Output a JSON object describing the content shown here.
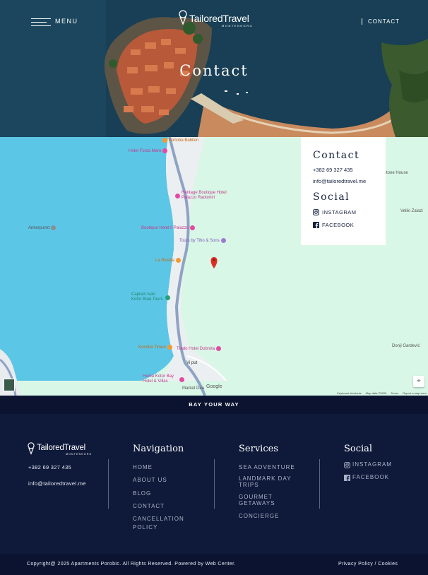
{
  "header": {
    "menu_label": "MENU",
    "logo_main": "TailoredTravel",
    "logo_sub": "MONTENEGRO",
    "contact_link": "CONTACT",
    "hero_title": "Contact"
  },
  "map": {
    "pois": [
      {
        "label": "Konoba Babilon",
        "color": "orange"
      },
      {
        "label": "Hotel Forza Mare",
        "color": "pink"
      },
      {
        "label": "Heritage Boutique Hotel Palazzo Radomiri",
        "color": "pink"
      },
      {
        "label": "Ankerpunkt",
        "color": "gray"
      },
      {
        "label": "Boutique Hotel Il Palazzo",
        "color": "pink"
      },
      {
        "label": "Tours by Tiho & Sons",
        "color": "purple"
      },
      {
        "label": "La Ricetta",
        "color": "orange"
      },
      {
        "label": "Captain Ivan Kotor Boat Tours",
        "color": "teal"
      },
      {
        "label": "Konoba Timun",
        "color": "orange"
      },
      {
        "label": "Tredo Hotel Dobrota",
        "color": "pink"
      },
      {
        "label": "Huma Kotor Bay Hotel & Villas",
        "color": "pink"
      },
      {
        "label": "Market Dea",
        "color": "gray"
      },
      {
        "label": "Stone House",
        "color": "gray"
      },
      {
        "label": "Veliki Zalazi",
        "color": "gray"
      },
      {
        "label": "Donji Gardević",
        "color": "gray"
      },
      {
        "label": "Vi put",
        "color": "gray"
      }
    ],
    "google": "Google",
    "footer_links": [
      "Keyboard shortcuts",
      "Map data ©2026",
      "Terms",
      "Report a map error"
    ]
  },
  "info_card": {
    "contact_heading": "Contact",
    "phone": "+382 69 327 435",
    "email": "info@tailoredtravel.me",
    "social_heading": "Social",
    "instagram": "INSTAGRAM",
    "facebook": "FACEBOOK"
  },
  "strip": {
    "text": "BAY YOUR WAY"
  },
  "footer": {
    "logo_main": "TailoredTravel",
    "logo_sub": "MONTENEGRO",
    "phone": "+382 69 327 435",
    "email": "info@tailoredtravel.me",
    "navigation": {
      "heading": "Navigation",
      "items": [
        "HOME",
        "ABOUT US",
        "BLOG",
        "CONTACT",
        "CANCELLATION POLICY"
      ]
    },
    "services": {
      "heading": "Services",
      "items": [
        "SEA ADVENTURE",
        "LANDMARK DAY TRIPS",
        "GOURMET GETAWAYS",
        "CONCIERGE"
      ]
    },
    "social": {
      "heading": "Social",
      "instagram": "INSTAGRAM",
      "facebook": "FACEBOOK"
    },
    "copyright": "Copyright@ 2025 Apartments Porobic. All Rights Reserved. Powered by Web Center.",
    "policy": "Privacy Policy / Cookies"
  },
  "colors": {
    "navy": "#0f1a3a",
    "map_water": "#5cc6e6",
    "map_land": "#d9f7e6",
    "pin": "#d93025"
  }
}
